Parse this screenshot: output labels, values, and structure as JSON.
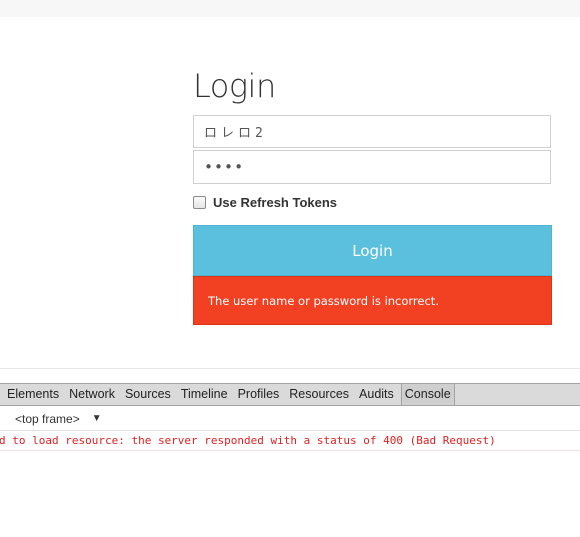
{
  "page": {
    "title": "Login",
    "username_value": "ロレロ2",
    "password_value": "••••",
    "remember_label": "Use Refresh Tokens",
    "remember_checked": false,
    "login_button": "Login",
    "error_message": "The user name or password is incorrect."
  },
  "devtools": {
    "tabs": [
      "Elements",
      "Network",
      "Sources",
      "Timeline",
      "Profiles",
      "Resources",
      "Audits",
      "Console"
    ],
    "active_tab": "Console",
    "frame_select": "<top frame>",
    "frame_caret": "▼",
    "console_error": "d to load resource: the server responded with a status of 400 (Bad Request)"
  },
  "colors": {
    "login_button_bg": "#5bc0de",
    "error_bg": "#f24023",
    "console_error_text": "#e02020"
  }
}
